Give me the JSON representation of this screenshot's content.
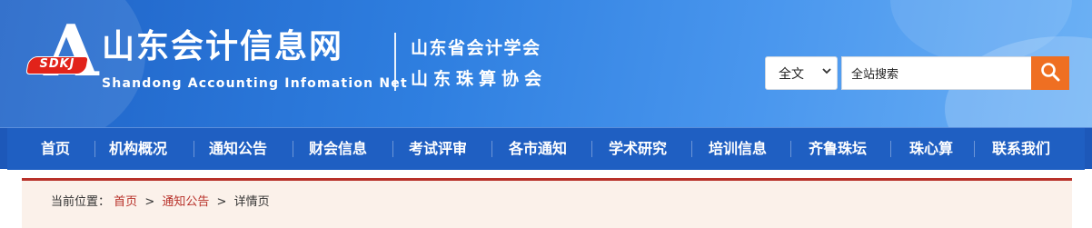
{
  "logo": {
    "badge_text": "SDKJ",
    "letter": "A",
    "title": "山东会计信息网",
    "subtitle": "Shandong Accounting Infomation Net"
  },
  "associations": {
    "line1": "山东省会计学会",
    "line2": "山东珠算协会"
  },
  "search": {
    "scope_selected": "全文",
    "placeholder": "全站搜索",
    "button_icon": "search-icon"
  },
  "nav": {
    "items": [
      {
        "label": "首页"
      },
      {
        "label": "机构概况"
      },
      {
        "label": "通知公告"
      },
      {
        "label": "财会信息"
      },
      {
        "label": "考试评审"
      },
      {
        "label": "各市通知"
      },
      {
        "label": "学术研究"
      },
      {
        "label": "培训信息"
      },
      {
        "label": "齐鲁珠坛"
      },
      {
        "label": "珠心算"
      },
      {
        "label": "联系我们"
      }
    ]
  },
  "breadcrumb": {
    "prefix": "当前位置：",
    "items": [
      "首页",
      "通知公告",
      "详情页"
    ],
    "separator": ">"
  },
  "colors": {
    "header_blue": "#2f7fe0",
    "nav_blue": "#1f5fc2",
    "accent_orange": "#ef6f22",
    "accent_red": "#b8312a",
    "crumb_bg": "#fbf1ea"
  }
}
